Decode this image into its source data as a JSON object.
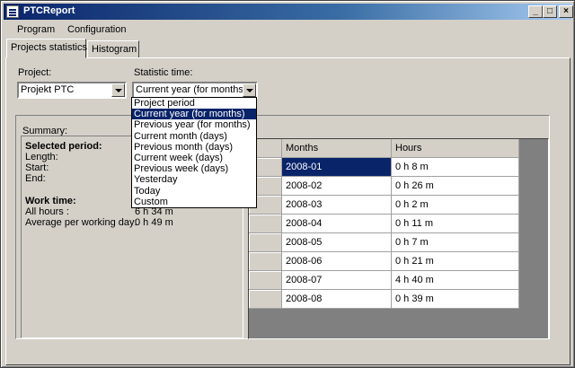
{
  "window": {
    "title": "PTCReport"
  },
  "menu": [
    "Program",
    "Configuration"
  ],
  "tabs": [
    "Projects statistics",
    "Histogram"
  ],
  "project": {
    "label": "Project:",
    "value": "Projekt PTC"
  },
  "statistic_time": {
    "label": "Statistic time:",
    "value": "Current year (for months)",
    "options": [
      "Project period",
      "Current year (for months)",
      "Previous year (for months)",
      "Current month (days)",
      "Previous month (days)",
      "Current week (days)",
      "Previous week (days)",
      "Yesterday",
      "Today",
      "Custom"
    ],
    "selected_index": 1
  },
  "summary": {
    "label": "Summary:",
    "selected_period": "Selected period:",
    "length": "Length:",
    "start": "Start:",
    "end": "End:",
    "work_time": "Work time:",
    "all_hours": "All hours :",
    "all_hours_value": "6 h 34 m",
    "avg_label": "Average per working day:",
    "avg_value": "0 h 49 m"
  },
  "grid": {
    "headers": [
      "Months",
      "Hours"
    ],
    "rows": [
      [
        "2008-01",
        "0 h 8 m"
      ],
      [
        "2008-02",
        "0 h 26 m"
      ],
      [
        "2008-03",
        "0 h 2 m"
      ],
      [
        "2008-04",
        "0 h 11 m"
      ],
      [
        "2008-05",
        "0 h 7 m"
      ],
      [
        "2008-06",
        "0 h 21 m"
      ],
      [
        "2008-07",
        "4 h 40 m"
      ],
      [
        "2008-08",
        "0 h 39 m"
      ]
    ],
    "selected_row": 0
  },
  "colors": {
    "titlebar": "#0a246a",
    "selection": "#0a246a",
    "face": "#d4d0c8"
  }
}
